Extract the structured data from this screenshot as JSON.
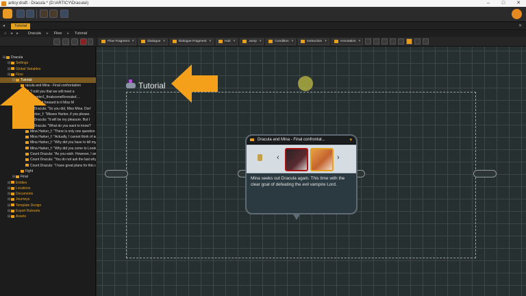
{
  "window": {
    "title": "articy:draft - Dracula * (D:\\ARTICY\\Dracula\\)",
    "controls": [
      "–",
      "□",
      "✕"
    ]
  },
  "tabs": [
    {
      "label": "Tutorial"
    }
  ],
  "breadcrumb": [
    "Dracula",
    "Flow",
    "Tutorial"
  ],
  "tree": [
    {
      "label": "Dracula",
      "indent": 0,
      "style": "normal"
    },
    {
      "label": "Settings",
      "indent": 1,
      "style": "org"
    },
    {
      "label": "Global Variables",
      "indent": 1,
      "style": "org"
    },
    {
      "label": "Flow",
      "indent": 1,
      "style": "org"
    },
    {
      "label": "Tutorial",
      "indent": 2,
      "style": "sel"
    },
    {
      "label": "racula and Mina - Final confrontation",
      "indent": 3,
      "style": "normal"
    },
    {
      "label": "\"I told you that we will meet a",
      "indent": 4,
      "style": "normal"
    },
    {
      "label": "{chapter1_finalsceneRevealed ...",
      "indent": 4,
      "style": "normal"
    },
    {
      "label": "\"I looked forward to it Miss M",
      "indent": 4,
      "style": "normal"
    },
    {
      "label": "nt Dracula: \"So you did, Miss Mina. Don'",
      "indent": 4,
      "style": "normal"
    },
    {
      "label": "Harker_f: \"Misses Harker, if you please.",
      "indent": 4,
      "style": "normal"
    },
    {
      "label": "nt Dracula: \"It will be my pleasure. But I",
      "indent": 4,
      "style": "normal"
    },
    {
      "label": "nt Dracula: \"What do you want to know?",
      "indent": 4,
      "style": "normal"
    },
    {
      "label": "Mina Harker_f: \"There is only one question I'",
      "indent": 4,
      "style": "normal"
    },
    {
      "label": "Mina Harker_f: \"Actually, I cannot think of an",
      "indent": 4,
      "style": "normal"
    },
    {
      "label": "Mina Harker_f: \"Why did you have to kill my",
      "indent": 4,
      "style": "normal"
    },
    {
      "label": "Mina Harker_f: \"Why did you come to Londo",
      "indent": 4,
      "style": "normal"
    },
    {
      "label": "Count Dracula: \"As you wish. However, I am",
      "indent": 4,
      "style": "normal"
    },
    {
      "label": "Count Dracula: \"You do not ask the last why",
      "indent": 4,
      "style": "normal"
    },
    {
      "label": "Count Dracula: \"I have great plans for this cit",
      "indent": 4,
      "style": "normal"
    },
    {
      "label": "Fight",
      "indent": 3,
      "style": "normal"
    },
    {
      "label": "Final",
      "indent": 2,
      "style": "normal"
    },
    {
      "label": "Entities",
      "indent": 1,
      "style": "org"
    },
    {
      "label": "Locations",
      "indent": 1,
      "style": "org"
    },
    {
      "label": "Documents",
      "indent": 1,
      "style": "org"
    },
    {
      "label": "Journeys",
      "indent": 1,
      "style": "org"
    },
    {
      "label": "Template Design",
      "indent": 1,
      "style": "org"
    },
    {
      "label": "Export Rulesets",
      "indent": 1,
      "style": "org"
    },
    {
      "label": "Assets",
      "indent": 1,
      "style": "org"
    }
  ],
  "canvas_toolbar": {
    "items": [
      "Flow Fragment",
      "Dialogue",
      "Dialogue Fragment",
      "Hub",
      "Jump",
      "Condition",
      "Instruction",
      "Annotation"
    ]
  },
  "flow": {
    "title": "Tutorial"
  },
  "node": {
    "title": "Dracula and Mina - Final confrontat...",
    "text": "Mina seeks out Dracula again. This time with the clear goal of defeating the evil vampire Lord."
  },
  "colors": {
    "accent": "#e6a01e",
    "annotation_arrow": "#f5a01a",
    "canvas": "#273030"
  }
}
